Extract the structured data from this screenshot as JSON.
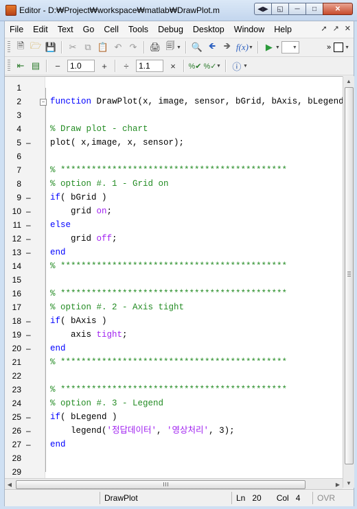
{
  "window": {
    "title": "Editor - D:₩Project₩workspace₩matlab₩DrawPlot.m",
    "controls": [
      "restore",
      "undock",
      "minimize",
      "maximize",
      "close"
    ]
  },
  "menu": {
    "items": [
      {
        "label": "File",
        "key": "F"
      },
      {
        "label": "Edit",
        "key": "E"
      },
      {
        "label": "Text",
        "key": "T"
      },
      {
        "label": "Go",
        "key": "G"
      },
      {
        "label": "Cell",
        "key": "C"
      },
      {
        "label": "Tools",
        "key": "o"
      },
      {
        "label": "Debug",
        "key": "b"
      },
      {
        "label": "Desktop",
        "key": "D"
      },
      {
        "label": "Window",
        "key": "W"
      },
      {
        "label": "Help",
        "key": "H"
      }
    ],
    "right_icons": [
      "dock-arrow",
      "undock-icon",
      "close-x"
    ]
  },
  "toolbar1": {
    "icons": [
      "new-file",
      "open-folder",
      "save",
      "cut",
      "copy",
      "paste",
      "undo",
      "redo",
      "print",
      "print-preview",
      "find-binoculars",
      "back-arrow",
      "forward-arrow",
      "function-fx",
      "run",
      "stack-select"
    ]
  },
  "toolbar2": {
    "minus_label": "−",
    "plus_label": "+",
    "divide_label": "÷",
    "times_label": "×",
    "increment_value": "1.0",
    "divide_value": "1.1"
  },
  "editor": {
    "lines": [
      {
        "n": "1",
        "dash": "",
        "fold": false,
        "segments": []
      },
      {
        "n": "2",
        "dash": "",
        "fold": true,
        "segments": [
          [
            "kw",
            "function"
          ],
          [
            "tx",
            " DrawPlot(x, image, sensor, bGrid, bAxis, bLegend"
          ]
        ]
      },
      {
        "n": "3",
        "dash": "",
        "fold": false,
        "segments": []
      },
      {
        "n": "4",
        "dash": "",
        "fold": false,
        "segments": [
          [
            "cm",
            "% Draw plot - chart"
          ]
        ]
      },
      {
        "n": "5",
        "dash": "–",
        "fold": false,
        "segments": [
          [
            "tx",
            "plot( x,image, x, sensor);"
          ]
        ]
      },
      {
        "n": "6",
        "dash": "",
        "fold": false,
        "segments": []
      },
      {
        "n": "7",
        "dash": "",
        "fold": false,
        "segments": [
          [
            "cm",
            "% ********************************************"
          ]
        ]
      },
      {
        "n": "8",
        "dash": "",
        "fold": false,
        "segments": [
          [
            "cm",
            "% option #. 1 - Grid on"
          ]
        ]
      },
      {
        "n": "9",
        "dash": "–",
        "fold": false,
        "segments": [
          [
            "kw",
            "if"
          ],
          [
            "tx",
            "( bGrid )"
          ]
        ]
      },
      {
        "n": "10",
        "dash": "–",
        "fold": false,
        "segments": [
          [
            "tx",
            "    grid "
          ],
          [
            "st",
            "on"
          ],
          [
            "tx",
            ";"
          ]
        ]
      },
      {
        "n": "11",
        "dash": "–",
        "fold": false,
        "segments": [
          [
            "kw",
            "else"
          ]
        ]
      },
      {
        "n": "12",
        "dash": "–",
        "fold": false,
        "segments": [
          [
            "tx",
            "    grid "
          ],
          [
            "st",
            "off"
          ],
          [
            "tx",
            ";"
          ]
        ]
      },
      {
        "n": "13",
        "dash": "–",
        "fold": false,
        "segments": [
          [
            "kw",
            "end"
          ]
        ]
      },
      {
        "n": "14",
        "dash": "",
        "fold": false,
        "segments": [
          [
            "cm",
            "% ********************************************"
          ]
        ]
      },
      {
        "n": "15",
        "dash": "",
        "fold": false,
        "segments": []
      },
      {
        "n": "16",
        "dash": "",
        "fold": false,
        "segments": [
          [
            "cm",
            "% ********************************************"
          ]
        ]
      },
      {
        "n": "17",
        "dash": "",
        "fold": false,
        "segments": [
          [
            "cm",
            "% option #. 2 - Axis tight"
          ]
        ]
      },
      {
        "n": "18",
        "dash": "–",
        "fold": false,
        "segments": [
          [
            "kw",
            "if"
          ],
          [
            "tx",
            "( bAxis )"
          ]
        ]
      },
      {
        "n": "19",
        "dash": "–",
        "fold": false,
        "segments": [
          [
            "tx",
            "    axis "
          ],
          [
            "st",
            "tight"
          ],
          [
            "tx",
            ";"
          ]
        ]
      },
      {
        "n": "20",
        "dash": "–",
        "fold": false,
        "segments": [
          [
            "kw",
            "end"
          ]
        ]
      },
      {
        "n": "21",
        "dash": "",
        "fold": false,
        "segments": [
          [
            "cm",
            "% ********************************************"
          ]
        ]
      },
      {
        "n": "22",
        "dash": "",
        "fold": false,
        "segments": []
      },
      {
        "n": "23",
        "dash": "",
        "fold": false,
        "segments": [
          [
            "cm",
            "% ********************************************"
          ]
        ]
      },
      {
        "n": "24",
        "dash": "",
        "fold": false,
        "segments": [
          [
            "cm",
            "% option #. 3 - Legend"
          ]
        ]
      },
      {
        "n": "25",
        "dash": "–",
        "fold": false,
        "segments": [
          [
            "kw",
            "if"
          ],
          [
            "tx",
            "( bLegend )"
          ]
        ]
      },
      {
        "n": "26",
        "dash": "–",
        "fold": false,
        "segments": [
          [
            "tx",
            "    legend("
          ],
          [
            "str",
            "'정답데이터'"
          ],
          [
            "tx",
            ", "
          ],
          [
            "str",
            "'영상처리'"
          ],
          [
            "tx",
            ", 3);"
          ]
        ]
      },
      {
        "n": "27",
        "dash": "–",
        "fold": false,
        "segments": [
          [
            "kw",
            "end"
          ]
        ]
      },
      {
        "n": "28",
        "dash": "",
        "fold": false,
        "segments": []
      },
      {
        "n": "29",
        "dash": "",
        "fold": false,
        "segments": []
      }
    ]
  },
  "status": {
    "file": "DrawPlot",
    "ln_label": "Ln",
    "ln_value": "20",
    "col_label": "Col",
    "col_value": "4",
    "mode": "OVR"
  },
  "colors": {
    "keyword": "#0000ff",
    "comment": "#228b22",
    "string": "#a020f0"
  }
}
